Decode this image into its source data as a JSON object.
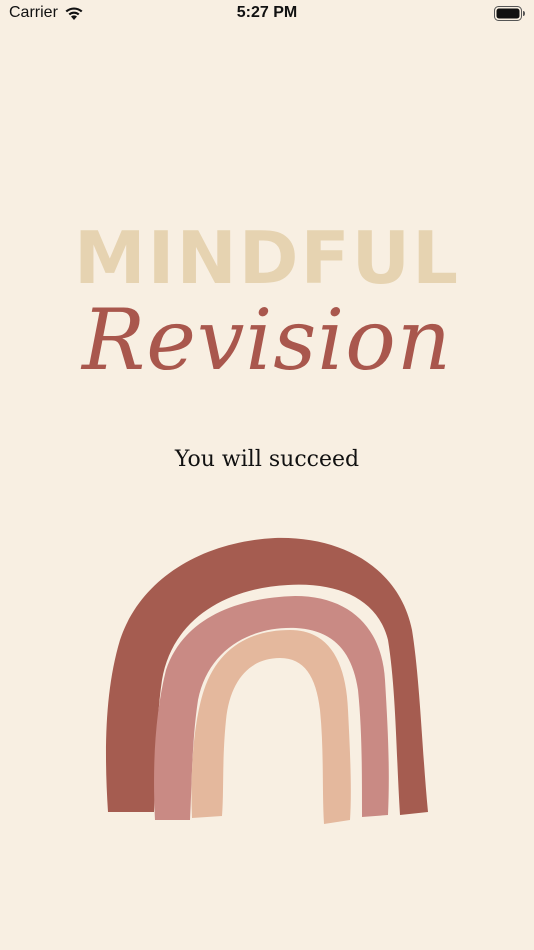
{
  "status_bar": {
    "carrier": "Carrier",
    "time": "5:27 PM"
  },
  "title": {
    "line1": "MINDFUL",
    "line2": "Revision"
  },
  "tagline": "You will succeed",
  "colors": {
    "background": "#f8efe2",
    "mindful_text": "#e6d3b1",
    "revision_text": "#a9574d",
    "rainbow_outer": "#a55c50",
    "rainbow_middle": "#c98a84",
    "rainbow_inner": "#e4b89d"
  }
}
